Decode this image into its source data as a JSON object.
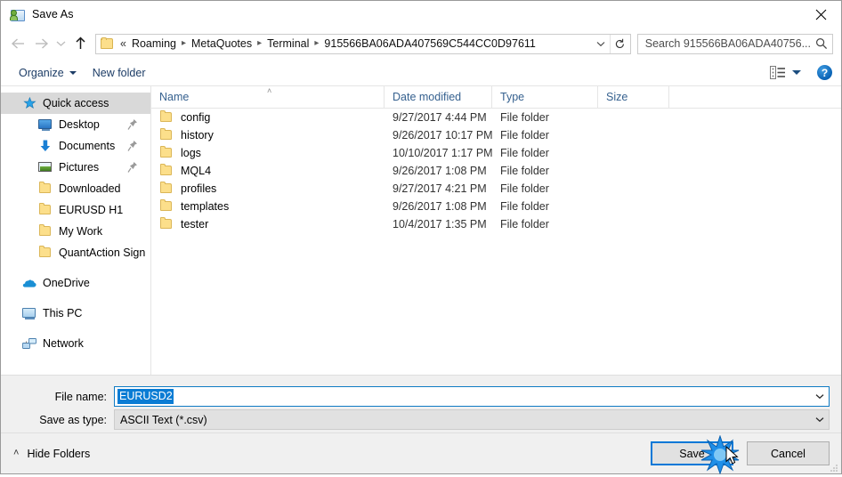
{
  "window": {
    "title": "Save As",
    "icon": "save-as-icon",
    "close_label": "✕"
  },
  "navigation": {
    "back_icon": "arrow-left-icon",
    "forward_icon": "arrow-right-icon",
    "recent_icon": "chevron-down-icon",
    "up_icon": "arrow-up-icon",
    "breadcrumbs": [
      {
        "label": "«",
        "type": "overflow"
      },
      {
        "label": "Roaming",
        "type": "crumb"
      },
      {
        "label": "MetaQuotes",
        "type": "crumb"
      },
      {
        "label": "Terminal",
        "type": "crumb"
      },
      {
        "label": "915566BA06ADA407569C544CC0D97611",
        "type": "crumb"
      }
    ],
    "address_dropdown_icon": "chevron-down-icon",
    "refresh_icon": "refresh-icon"
  },
  "search": {
    "placeholder": "Search 915566BA06ADA40756...",
    "icon": "search-icon"
  },
  "toolbar": {
    "organize_label": "Organize",
    "new_folder_label": "New folder",
    "view_icon": "view-options-icon",
    "view_caret_icon": "chevron-down-icon",
    "help_label": "?",
    "help_icon": "help-icon"
  },
  "sidebar": {
    "items": [
      {
        "label": "Quick access",
        "icon": "star-icon",
        "level": 0,
        "selected": true,
        "pinned": false
      },
      {
        "label": "Desktop",
        "icon": "monitor-icon",
        "level": 1,
        "selected": false,
        "pinned": true
      },
      {
        "label": "Documents",
        "icon": "download-arrow-icon",
        "level": 1,
        "selected": false,
        "pinned": true
      },
      {
        "label": "Pictures",
        "icon": "pictures-icon",
        "level": 1,
        "selected": false,
        "pinned": true
      },
      {
        "label": "Downloaded",
        "icon": "folder-icon",
        "level": 1,
        "selected": false,
        "pinned": false
      },
      {
        "label": "EURUSD H1",
        "icon": "folder-icon",
        "level": 1,
        "selected": false,
        "pinned": false
      },
      {
        "label": "My Work",
        "icon": "folder-icon",
        "level": 1,
        "selected": false,
        "pinned": false
      },
      {
        "label": "QuantAction Signal",
        "icon": "folder-icon",
        "level": 1,
        "selected": false,
        "pinned": false
      },
      {
        "label": "OneDrive",
        "icon": "onedrive-icon",
        "level": 0,
        "selected": false,
        "pinned": false
      },
      {
        "label": "This PC",
        "icon": "this-pc-icon",
        "level": 0,
        "selected": false,
        "pinned": false
      },
      {
        "label": "Network",
        "icon": "network-icon",
        "level": 0,
        "selected": false,
        "pinned": false
      }
    ]
  },
  "filelist": {
    "columns": [
      {
        "key": "name",
        "label": "Name",
        "sorted": "asc"
      },
      {
        "key": "date",
        "label": "Date modified",
        "sorted": ""
      },
      {
        "key": "type",
        "label": "Type",
        "sorted": ""
      },
      {
        "key": "size",
        "label": "Size",
        "sorted": ""
      }
    ],
    "sort_caret": "˄",
    "rows": [
      {
        "name": "config",
        "date": "9/27/2017 4:44 PM",
        "type": "File folder",
        "size": "",
        "icon": "folder-icon"
      },
      {
        "name": "history",
        "date": "9/26/2017 10:17 PM",
        "type": "File folder",
        "size": "",
        "icon": "folder-icon"
      },
      {
        "name": "logs",
        "date": "10/10/2017 1:17 PM",
        "type": "File folder",
        "size": "",
        "icon": "folder-icon"
      },
      {
        "name": "MQL4",
        "date": "9/26/2017 1:08 PM",
        "type": "File folder",
        "size": "",
        "icon": "folder-icon"
      },
      {
        "name": "profiles",
        "date": "9/27/2017 4:21 PM",
        "type": "File folder",
        "size": "",
        "icon": "folder-icon"
      },
      {
        "name": "templates",
        "date": "9/26/2017 1:08 PM",
        "type": "File folder",
        "size": "",
        "icon": "folder-icon"
      },
      {
        "name": "tester",
        "date": "10/4/2017 1:35 PM",
        "type": "File folder",
        "size": "",
        "icon": "folder-icon"
      }
    ]
  },
  "form": {
    "filename_label": "File name:",
    "filename_value": "EURUSD2",
    "filename_dropdown_icon": "chevron-down-icon",
    "savetype_label": "Save as type:",
    "savetype_value": "ASCII Text (*.csv)",
    "savetype_dropdown_icon": "chevron-down-icon"
  },
  "actions": {
    "hide_folders_label": "Hide Folders",
    "hide_folders_caret": "˄",
    "save_label": "Save",
    "cancel_label": "Cancel"
  },
  "colors": {
    "accent": "#0078d7",
    "selection": "#0a7cd4",
    "sidebar_selected": "#d9d9d9",
    "header_text": "#36618f",
    "folder_yellow": "#fcdf8b",
    "dialog_chrome": "#f0f0f0"
  }
}
